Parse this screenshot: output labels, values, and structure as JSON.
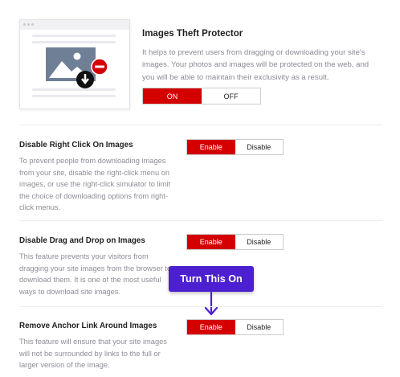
{
  "hero": {
    "title": "Images Theft Protector",
    "description": "It helps to prevent users from dragging or downloading your site's images. Your photos and images will be protected on the web, and you will be able to maintain their exclusivity as a result.",
    "toggle": {
      "on_label": "ON",
      "off_label": "OFF",
      "selected": "ON"
    }
  },
  "sections": [
    {
      "title": "Disable Right Click On Images",
      "description": "To prevent people from downloading images from your site, disable the right-click menu on images, or use the right-click simulator to limit the choice of downloading options from right-click menus.",
      "enable_label": "Enable",
      "disable_label": "Disable",
      "selected": "Enable"
    },
    {
      "title": "Disable Drag and Drop on Images",
      "description": "This feature prevents your visitors from dragging your site images from the browser to download them. It is one of the most useful ways to download site images.",
      "enable_label": "Enable",
      "disable_label": "Disable",
      "selected": "Enable"
    },
    {
      "title": "Remove Anchor Link Around Images",
      "description": "This feature will ensure that your site images will not be surrounded by links to the full or larger version of the image.",
      "enable_label": "Enable",
      "disable_label": "Disable",
      "selected": "Enable"
    }
  ],
  "callout": {
    "text": "Turn This On"
  },
  "colors": {
    "accent": "#d40000",
    "callout": "#4c1fd1",
    "illustration": "#6f7f96"
  }
}
